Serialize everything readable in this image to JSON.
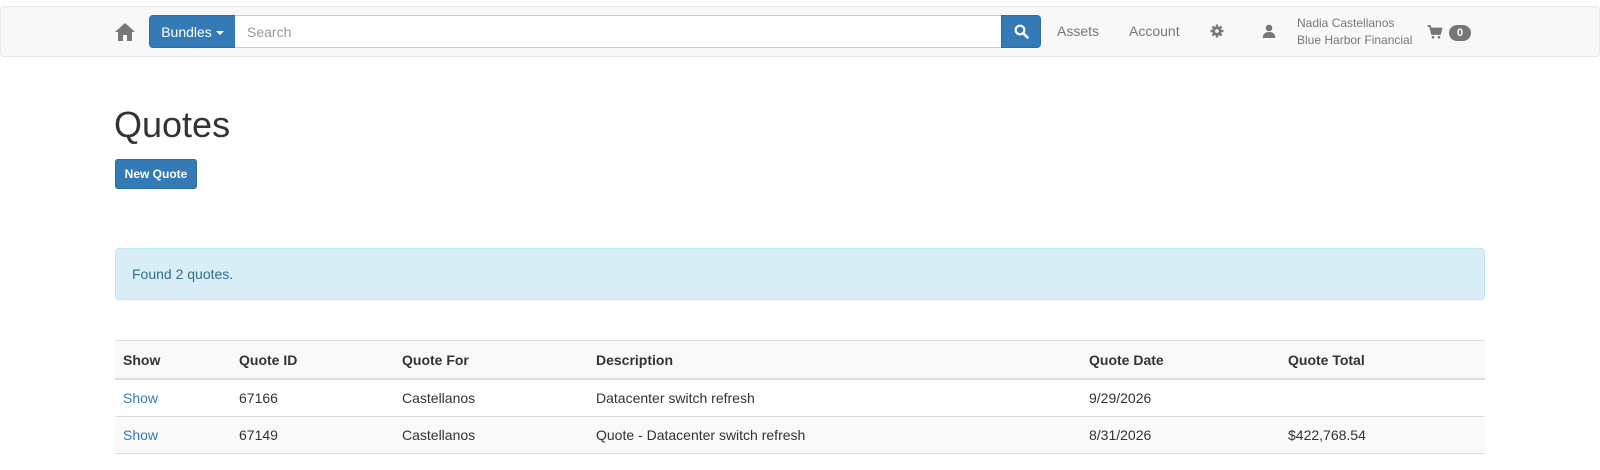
{
  "nav": {
    "bundles_label": "Bundles",
    "search_placeholder": "Search",
    "search_value": "",
    "assets_label": "Assets",
    "account_label": "Account",
    "user_name": "Nadia Castellanos",
    "company_name": "Blue Harbor Financial",
    "cart_count": "0"
  },
  "page": {
    "title": "Quotes",
    "new_quote_label": "New Quote",
    "alert_text": "Found 2 quotes."
  },
  "table": {
    "headers": [
      "Show",
      "Quote ID",
      "Quote For",
      "Description",
      "Quote Date",
      "Quote Total"
    ],
    "rows": [
      {
        "show": "Show",
        "id": "67166",
        "for": "Castellanos",
        "description": "Datacenter switch refresh",
        "date": "9/29/2026",
        "total": ""
      },
      {
        "show": "Show",
        "id": "67149",
        "for": "Castellanos",
        "description": "Quote - Datacenter switch refresh",
        "date": "8/31/2026",
        "total": "$422,768.54"
      }
    ]
  },
  "colors": {
    "primary": "#337ab7",
    "info_bg": "#d9edf7",
    "info_text": "#31708f",
    "nav_text": "#777777"
  },
  "icons": {
    "home": "home-icon",
    "search": "search-icon",
    "settings": "gear-icon",
    "user": "user-icon",
    "cart": "cart-icon"
  }
}
